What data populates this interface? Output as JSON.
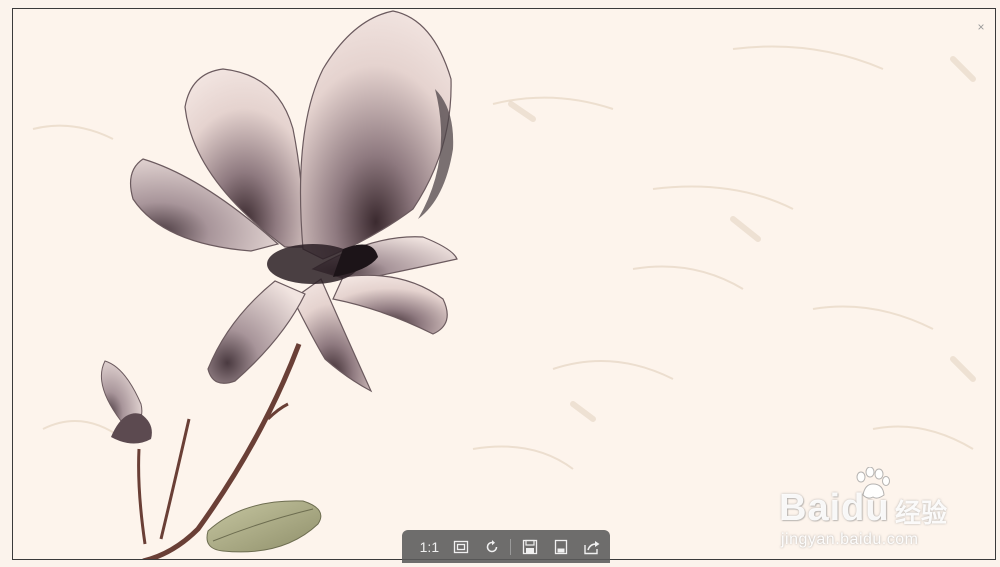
{
  "window": {
    "close_icon": "close-icon",
    "close_glyph": "×"
  },
  "watermark": {
    "brand": "Baidu",
    "cn_text": "经验",
    "url": "jingyan.baidu.com",
    "icon": "paw-icon"
  },
  "toolbar": {
    "actual_size_label": "1:1",
    "buttons": [
      {
        "name": "actual-size",
        "icon": "actual-size-icon"
      },
      {
        "name": "fit-window",
        "icon": "fit-window-icon"
      },
      {
        "name": "rotate",
        "icon": "rotate-icon"
      },
      {
        "name": "save",
        "icon": "save-icon"
      },
      {
        "name": "save-as",
        "icon": "save-as-icon"
      },
      {
        "name": "share",
        "icon": "share-icon"
      }
    ]
  },
  "colors": {
    "background": "#fdf4ec",
    "petal": "#e8d6d2",
    "petal_shadow": "#6b5a5e",
    "stem": "#6a3f36",
    "leaf": "#a9ab86",
    "toolbar": "#5a5a5a"
  }
}
